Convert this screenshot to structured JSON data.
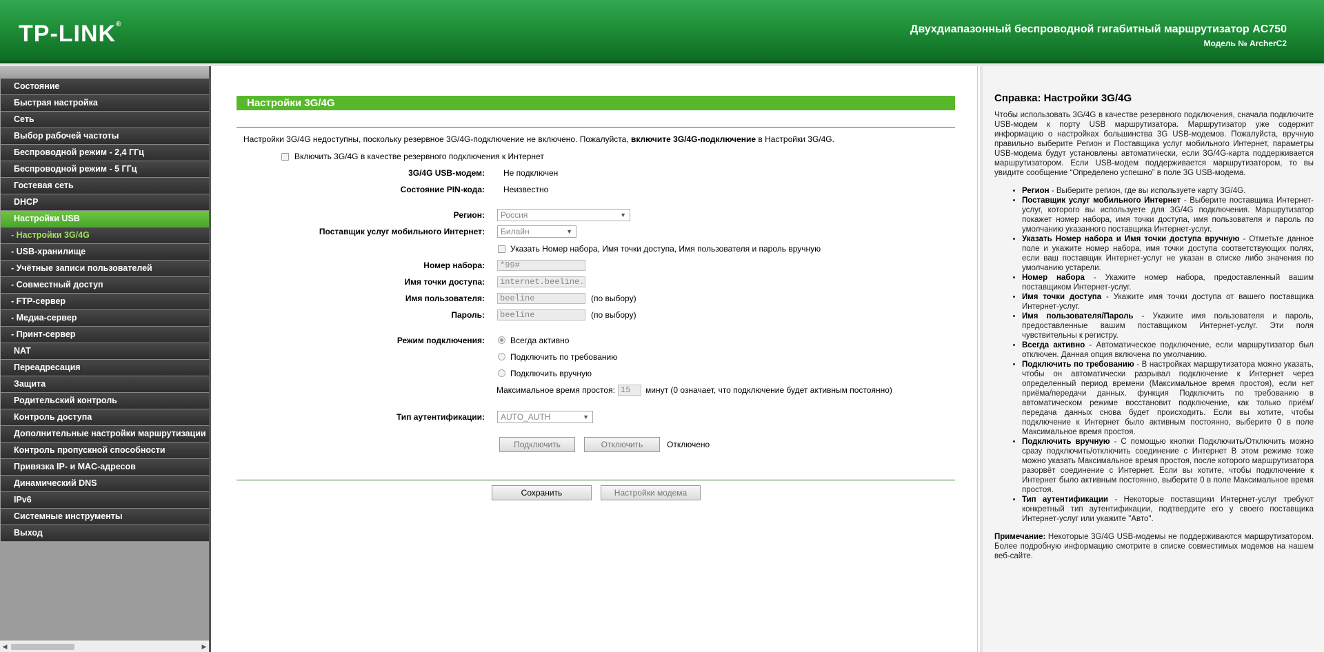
{
  "header": {
    "logo": "TP-LINK",
    "logo_mark": "®",
    "product": "Двухдиапазонный беспроводной гигабитный маршрутизатор AC750",
    "model": "Модель № ArcherC2"
  },
  "nav": [
    {
      "label": "Состояние",
      "type": "item"
    },
    {
      "label": "Быстрая настройка",
      "type": "item"
    },
    {
      "label": "Сеть",
      "type": "item"
    },
    {
      "label": "Выбор рабочей частоты",
      "type": "item"
    },
    {
      "label": "Беспроводной режим - 2,4 ГГц",
      "type": "item"
    },
    {
      "label": "Беспроводной режим - 5 ГГц",
      "type": "item"
    },
    {
      "label": "Гостевая сеть",
      "type": "item"
    },
    {
      "label": "DHCP",
      "type": "item"
    },
    {
      "label": "Настройки USB",
      "type": "active"
    },
    {
      "label": "- Настройки 3G/4G",
      "type": "current"
    },
    {
      "label": "- USB-хранилище",
      "type": "sub"
    },
    {
      "label": "- Учётные записи пользователей",
      "type": "sub"
    },
    {
      "label": "- Совместный доступ",
      "type": "sub"
    },
    {
      "label": "- FTP-сервер",
      "type": "sub"
    },
    {
      "label": "- Медиа-сервер",
      "type": "sub"
    },
    {
      "label": "- Принт-сервер",
      "type": "sub"
    },
    {
      "label": "NAT",
      "type": "item"
    },
    {
      "label": "Переадресация",
      "type": "item"
    },
    {
      "label": "Защита",
      "type": "item"
    },
    {
      "label": "Родительский контроль",
      "type": "item"
    },
    {
      "label": "Контроль доступа",
      "type": "item"
    },
    {
      "label": "Дополнительные настройки маршрутизации",
      "type": "item"
    },
    {
      "label": "Контроль пропускной способности",
      "type": "item"
    },
    {
      "label": "Привязка IP- и MAC-адресов",
      "type": "item"
    },
    {
      "label": "Динамический DNS",
      "type": "item"
    },
    {
      "label": "IPv6",
      "type": "item"
    },
    {
      "label": "Системные инструменты",
      "type": "item"
    },
    {
      "label": "Выход",
      "type": "item"
    }
  ],
  "main": {
    "title": "Настройки 3G/4G",
    "notice_pre": "Настройки 3G/4G недоступны, поскольку резервное 3G/4G-подключение не включено. Пожалуйста, ",
    "notice_bold": "включите 3G/4G-подключение",
    "notice_post": " в Настройки 3G/4G.",
    "enable_backup_label": "Включить 3G/4G в качестве резервного подключения к Интернет",
    "modem_label": "3G/4G USB-модем:",
    "modem_value": "Не подключен",
    "pin_label": "Состояние PIN-кода:",
    "pin_value": "Неизвестно",
    "region_label": "Регион:",
    "region_value": "Россия",
    "isp_label": "Поставщик услуг мобильного Интернет:",
    "isp_value": "Билайн",
    "manual_label": "Указать Номер набора, Имя точки доступа, Имя пользователя и пароль вручную",
    "dial_label": "Номер набора:",
    "dial_value": "*99#",
    "apn_label": "Имя точки доступа:",
    "apn_value": "internet.beeline.ru",
    "user_label": "Имя пользователя:",
    "user_value": "beeline",
    "pass_label": "Пароль:",
    "pass_value": "beeline",
    "optional": "(по выбору)",
    "mode_label": "Режим подключения:",
    "mode_always": "Всегда активно",
    "mode_demand": "Подключить по требованию",
    "mode_manual": "Подключить вручную",
    "idle_label": "Максимальное время простоя:",
    "idle_value": "15",
    "idle_hint": "минут (0 означает, что подключение будет активным постоянно)",
    "auth_label": "Тип аутентификации:",
    "auth_value": "AUTO_AUTH",
    "connect_btn": "Подключить",
    "disconnect_btn": "Отключить",
    "conn_status": "Отключено",
    "save_btn": "Сохранить",
    "modem_settings_btn": "Настройки модема"
  },
  "help": {
    "title": "Справка: Настройки 3G/4G",
    "intro": "Чтобы использовать 3G/4G в качестве резервного подключения, сначала подключите USB-модем к порту USB маршрутизатора. Маршрутизатор уже содержит информацию о настройках большинства 3G USB-модемов. Пожалуйста, вручную правильно выберите Регион и Поставщика услуг мобильного Интернет, параметры USB-модема будут установлены автоматически, если 3G/4G-карта поддерживается маршрутизатором. Если USB-модем поддерживается маршрутизатором, то вы увидите сообщение “Определено успешно” в поле 3G USB-модема.",
    "items": [
      {
        "b": "Регион",
        "t": " - Выберите регион, где вы используете карту 3G/4G."
      },
      {
        "b": "Поставщик услуг мобильного Интернет",
        "t": " - Выберите поставщика Интернет-услуг, которого вы используете для 3G/4G подключения. Маршрутизатор покажет номер набора, имя точки доступа, имя пользователя и пароль по умолчанию указанного поставщика Интернет-услуг."
      },
      {
        "b": "Указать Номер набора и Имя точки доступа вручную",
        "t": " - Отметьте данное поле и укажите номер набора, имя точки доступа соответствующих полях, если ваш поставщик Интернет-услуг не указан в списке либо значения по умолчанию устарели."
      },
      {
        "b": "Номер набора",
        "t": " - Укажите номер набора, предоставленный вашим поставщиком Интернет-услуг."
      },
      {
        "b": "Имя точки доступа",
        "t": " - Укажите имя точки доступа от вашего поставщика Интернет-услуг."
      },
      {
        "b": "Имя пользователя/Пароль",
        "t": " - Укажите имя пользователя и пароль, предоставленные вашим поставщиком Интернет-услуг. Эти поля чувствительны к регистру."
      },
      {
        "b": "Всегда активно",
        "t": " - Автоматическое подключение, если маршрутизатор был отключен. Данная опция включена по умолчанию."
      },
      {
        "b": "Подключить по требованию",
        "t": " - В настройках маршрутизатора можно указать, чтобы он автоматически разрывал подключение к Интернет через определенный период времени (Максимальное время простоя), если нет приёма/передачи данных. функция Подключить по требованию в автоматическом режиме восстановит подключение, как только приём/передача данных снова будет происходить. Если вы хотите, чтобы подключение к Интернет было активным постоянно, выберите 0 в поле Максимальное время простоя."
      },
      {
        "b": "Подключить вручную",
        "t": " - С помощью кнопки Подключить/Отключить можно сразу подключить/отключить соединение с Интернет В этом режиме тоже можно указать Максимальное время простоя, после которого маршрутизатора разорвёт соединение с Интернет. Если вы хотите, чтобы подключение к Интернет было активным постоянно, выберите 0 в поле Максимальное время простоя."
      },
      {
        "b": "Тип аутентификации",
        "t": " - Некоторые поставщики Интернет-услуг требуют конкретный тип аутентификации, подтвердите его у своего поставщика Интернет-услуг или укажите \"Авто\"."
      }
    ],
    "note_b": "Примечание:",
    "note_t": " Некоторые 3G/4G USB-модемы не поддерживаются маршрутизатором. Более подробную информацию смотрите в списке совместимых модемов на нашем веб-сайте."
  }
}
